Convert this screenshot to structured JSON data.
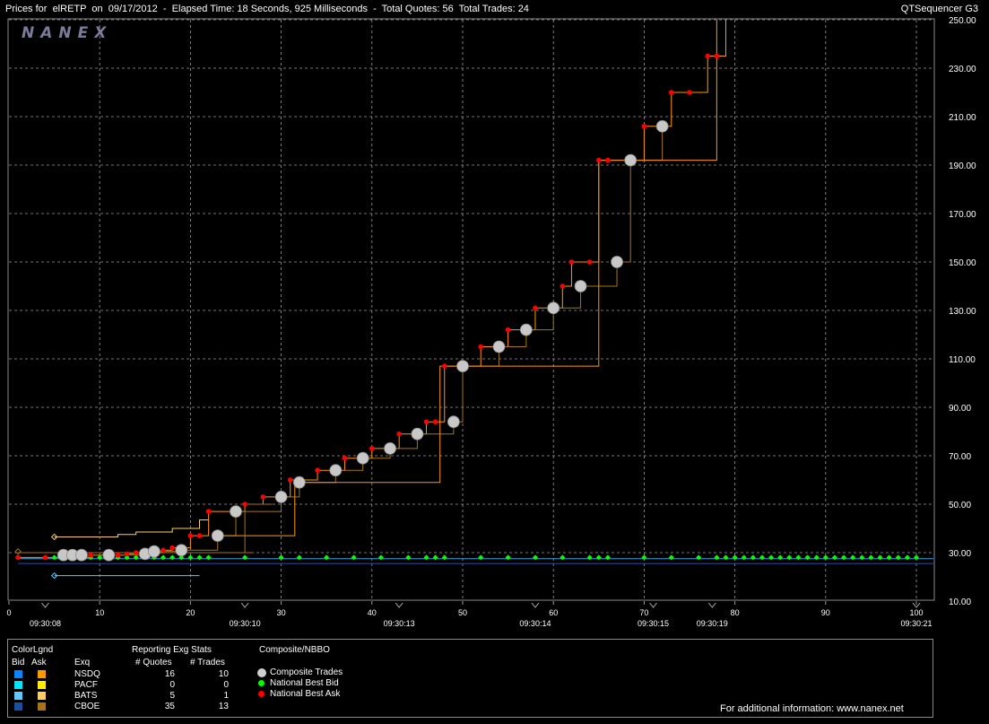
{
  "header": {
    "title": "Prices for  elRETP  on  09/17/2012  -  Elapsed Time: 18 Seconds, 925 Milliseconds  -  Total Quotes: 56  Total Trades: 24",
    "app_name": "QTSequencer G3",
    "logo_text": "NANEX"
  },
  "chart_data": {
    "type": "line",
    "xlim": [
      0,
      100
    ],
    "ylim": [
      10,
      250
    ],
    "x_ticks": [
      0,
      10,
      20,
      30,
      40,
      50,
      60,
      70,
      80,
      90,
      100
    ],
    "y_ticks": [
      10,
      30,
      50,
      70,
      90,
      110,
      130,
      150,
      170,
      190,
      210,
      230,
      250
    ],
    "y_tick_labels": [
      "10.00",
      "30.00",
      "50.00",
      "70.00",
      "90.00",
      "110.00",
      "130.00",
      "150.00",
      "170.00",
      "190.00",
      "210.00",
      "230.00",
      "250.00"
    ],
    "time_labels": [
      {
        "x": 4,
        "label": "09:30:08"
      },
      {
        "x": 26,
        "label": "09:30:10"
      },
      {
        "x": 43,
        "label": "09:30:13"
      },
      {
        "x": 58,
        "label": "09:30:14"
      },
      {
        "x": 71,
        "label": "09:30:15"
      },
      {
        "x": 77.5,
        "label": "09:30:19"
      },
      {
        "x": 100,
        "label": "09:30:21"
      }
    ],
    "grid": true,
    "series": [
      {
        "name": "Composite Trades",
        "color": "#c8c8c8",
        "x": [
          6,
          7,
          8,
          11,
          15,
          16,
          19,
          23,
          25,
          30,
          32,
          36,
          39,
          42,
          45,
          49,
          50,
          54,
          57,
          60,
          63,
          67,
          68.5,
          72
        ],
        "y": [
          29,
          29,
          29,
          29,
          29.5,
          30.5,
          31,
          37,
          47,
          53,
          59,
          64,
          69,
          73,
          79,
          84,
          107,
          115,
          122,
          131,
          140,
          150,
          192,
          206
        ]
      },
      {
        "name": "National Best Bid",
        "color": "#00ff00",
        "x": [
          1,
          4,
          5,
          6,
          7,
          8,
          9,
          10,
          11,
          12,
          13,
          14,
          15,
          16,
          17,
          18,
          19,
          20,
          21,
          22,
          26,
          30,
          32,
          35,
          38,
          41,
          44,
          46,
          47,
          48,
          52,
          55,
          58,
          61,
          64,
          65,
          66,
          70,
          73,
          76,
          78,
          79,
          80,
          81,
          82,
          83,
          84,
          85,
          86,
          87,
          88,
          89,
          90,
          91,
          92,
          93,
          94,
          95,
          96,
          97,
          98,
          99,
          100
        ],
        "y": [
          28,
          28,
          28,
          28,
          28,
          28,
          28,
          28,
          28,
          28,
          28,
          28,
          28,
          28,
          28,
          28,
          28,
          28,
          28,
          28,
          28,
          28,
          28,
          28,
          28,
          28,
          28,
          28,
          28,
          28,
          28,
          28,
          28,
          28,
          28,
          28,
          28,
          28,
          28,
          28,
          28,
          28,
          28,
          28,
          28,
          28,
          28,
          28,
          28,
          28,
          28,
          28,
          28,
          28,
          28,
          28,
          28,
          28,
          28,
          28,
          28,
          28,
          28
        ]
      },
      {
        "name": "National Best Ask",
        "color": "#ff0000",
        "x": [
          1,
          4,
          9,
          11,
          12,
          13,
          14,
          15,
          17,
          18,
          20,
          21,
          22,
          26,
          28,
          31,
          34,
          37,
          40,
          43,
          46,
          47,
          48,
          52,
          55,
          58,
          61,
          62,
          64,
          65,
          66,
          70,
          73,
          75,
          77,
          78
        ],
        "y": [
          28,
          28,
          29,
          29,
          29,
          29.5,
          30,
          30,
          31,
          32,
          37,
          37,
          47,
          50,
          53,
          60,
          64,
          69,
          73,
          79,
          84,
          84,
          107,
          115,
          122,
          131,
          140,
          150,
          150,
          192,
          192,
          206,
          220,
          220,
          235,
          235
        ]
      }
    ]
  },
  "legend": {
    "color_legend_title": "ColorLgnd",
    "bid_header": "Bid",
    "ask_header": "Ask",
    "exq_header": "Exq",
    "stats_title": "Reporting Exg Stats",
    "quotes_header": "# Quotes",
    "trades_header": "# Trades",
    "composite_title": "Composite/NBBO",
    "exchanges": [
      {
        "name": "NSDQ",
        "quotes": "16",
        "trades": "10",
        "bid_color": "#0a84ff",
        "ask_color": "#ff9900"
      },
      {
        "name": "PACF",
        "quotes": "0",
        "trades": "0",
        "bid_color": "#00e5ff",
        "ask_color": "#ffee00"
      },
      {
        "name": "BATS",
        "quotes": "5",
        "trades": "1",
        "bid_color": "#5ec8ff",
        "ask_color": "#ffcc66"
      },
      {
        "name": "CBOE",
        "quotes": "35",
        "trades": "13",
        "bid_color": "#1a4fa0",
        "ask_color": "#a87415"
      }
    ],
    "composite_items": [
      {
        "label": "Composite Trades",
        "color": "#d0d0d0"
      },
      {
        "label": "National Best Bid",
        "color": "#00ff00"
      },
      {
        "label": "National Best Ask",
        "color": "#ff0000"
      }
    ],
    "footer": "For additional information: www.nanex.net"
  }
}
